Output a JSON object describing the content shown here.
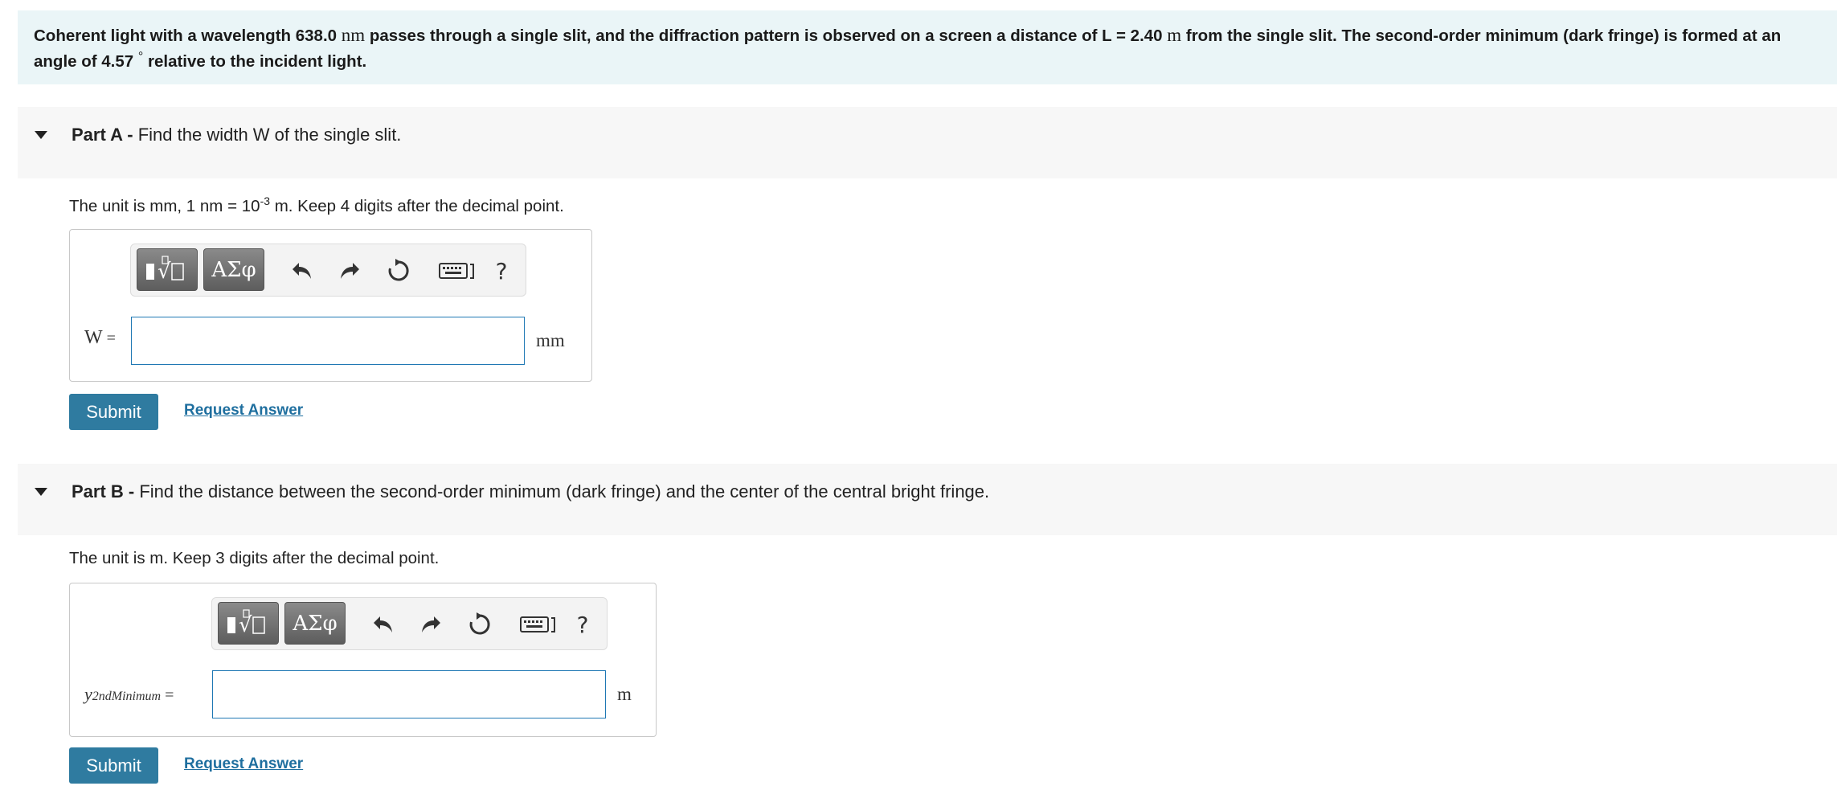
{
  "problem": {
    "t1": "Coherent light with a wavelength 638.0 ",
    "u1": "nm",
    "t2": " passes through a single slit, and the diffraction pattern is observed on a screen a distance of L = 2.40 ",
    "u2": "m",
    "t3": " from the single slit. The second-order minimum (dark fringe) is formed at an angle of 4.57 ",
    "deg": "°",
    "t4": " relative to the incident light."
  },
  "partA": {
    "label": "Part A - ",
    "title": "Find the width W of the single slit.",
    "instr_pre": "The unit is mm, 1 nm = 10",
    "instr_sup": "-3",
    "instr_post": " m. Keep 4 digits after the decimal point.",
    "var": "W",
    "eq": " =",
    "value": "",
    "unit": "mm",
    "submit": "Submit",
    "request": "Request Answer"
  },
  "partB": {
    "label": "Part B - ",
    "title": "Find the distance between the second-order minimum (dark fringe) and the center of the central bright fringe.",
    "instr": "The unit is m. Keep 3 digits after the decimal point.",
    "var_main": "y",
    "var_sub": "2ndMinimum",
    "eq": " =",
    "value": "",
    "unit": "m",
    "submit": "Submit",
    "request": "Request Answer"
  },
  "toolbar": {
    "greek": "ΑΣφ",
    "help": "?",
    "icons": [
      "templates-icon",
      "greek-symbols-icon",
      "undo-icon",
      "redo-icon",
      "reset-icon",
      "keyboard-icon",
      "help-icon"
    ]
  },
  "colors": {
    "accent": "#2f7ba0",
    "link": "#1f6f9f",
    "input_border": "#1f78b4",
    "problem_bg": "#eaf5f7"
  }
}
